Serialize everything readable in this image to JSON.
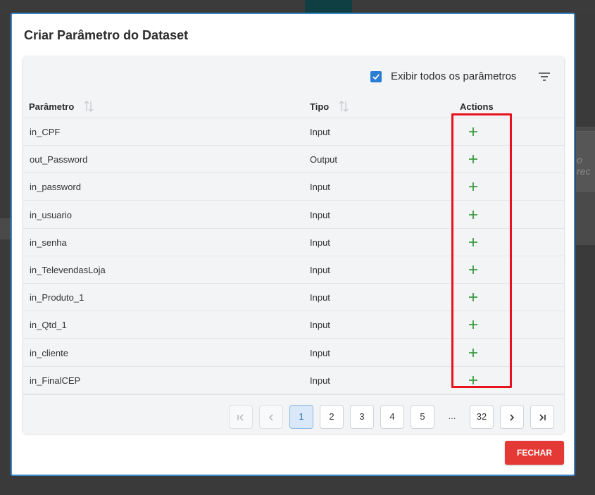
{
  "background": {
    "partial_text": "o rec"
  },
  "modal": {
    "title": "Criar Parâmetro do Dataset"
  },
  "toolbar": {
    "show_all_label": "Exibir todos os parâmetros",
    "show_all_checked": true
  },
  "table": {
    "columns": [
      "Parâmetro",
      "Tipo",
      "Actions"
    ],
    "rows": [
      {
        "name": "in_CPF",
        "type": "Input"
      },
      {
        "name": "out_Password",
        "type": "Output"
      },
      {
        "name": "in_password",
        "type": "Input"
      },
      {
        "name": "in_usuario",
        "type": "Input"
      },
      {
        "name": "in_senha",
        "type": "Input"
      },
      {
        "name": "in_TelevendasLoja",
        "type": "Input"
      },
      {
        "name": "in_Produto_1",
        "type": "Input"
      },
      {
        "name": "in_Qtd_1",
        "type": "Input"
      },
      {
        "name": "in_cliente",
        "type": "Input"
      },
      {
        "name": "in_FinalCEP",
        "type": "Input"
      }
    ],
    "action_icon": "plus-icon"
  },
  "pagination": {
    "pages": [
      "1",
      "2",
      "3",
      "4",
      "5"
    ],
    "ellipsis": "...",
    "last_page": "32",
    "current": "1"
  },
  "footer": {
    "close_label": "FECHAR"
  },
  "colors": {
    "accent": "#2b7fd3",
    "close": "#e53935",
    "highlight": "#e8121c",
    "add": "#3a9a3f"
  }
}
